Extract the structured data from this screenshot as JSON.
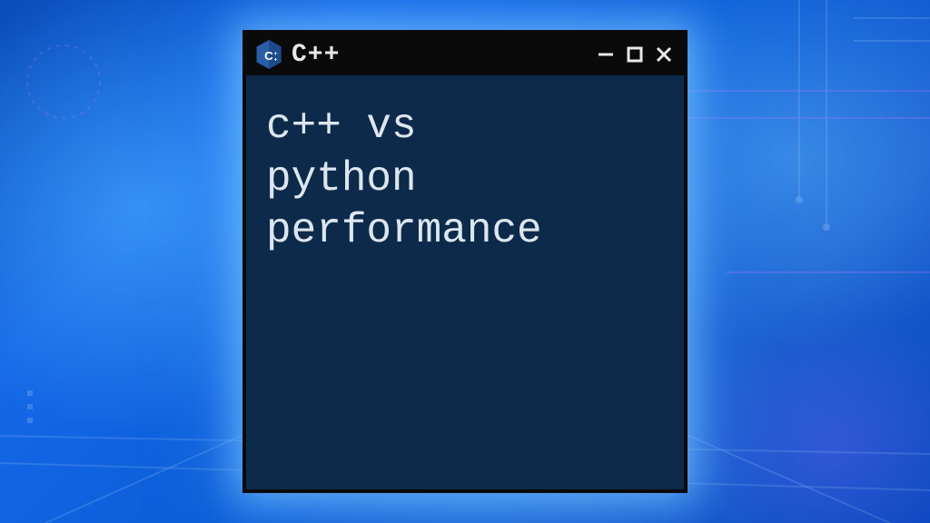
{
  "window": {
    "title": "C++",
    "icon_name": "cpp-hex-logo",
    "controls": {
      "minimize": "—",
      "maximize": "□",
      "close": "×"
    }
  },
  "content": {
    "text": "c++ vs\npython\nperformance"
  }
}
